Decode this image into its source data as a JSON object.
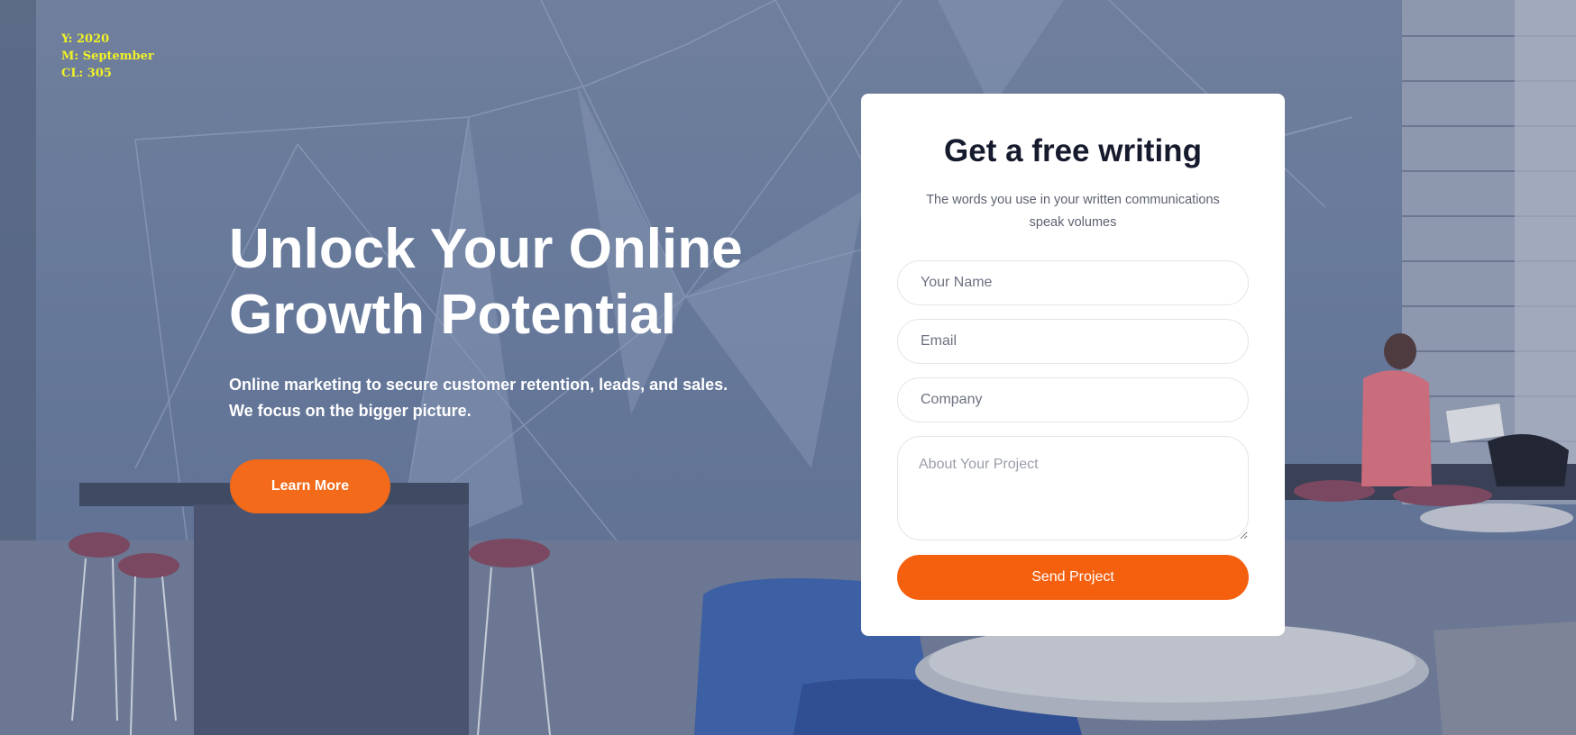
{
  "overlay": {
    "year": "Y: 2020",
    "month": "M: September",
    "cl": "CL: 305"
  },
  "hero": {
    "headline_line1": "Unlock Your Online",
    "headline_line2": "Growth Potential",
    "subtext_line1": "Online marketing to secure customer retention, leads, and sales.",
    "subtext_line2": "We focus on the bigger picture.",
    "cta_label": "Learn More"
  },
  "form": {
    "title": "Get a free writing",
    "subtitle_line1": "The words you use in your written communications",
    "subtitle_line2": "speak volumes",
    "name_placeholder": "Your Name",
    "email_placeholder": "Email",
    "company_placeholder": "Company",
    "project_placeholder": "About Your Project",
    "submit_label": "Send Project"
  },
  "colors": {
    "accent": "#f5600f",
    "overlay": "#6a7a99",
    "title": "#161a2d",
    "overlay_text": "#f2f227"
  }
}
